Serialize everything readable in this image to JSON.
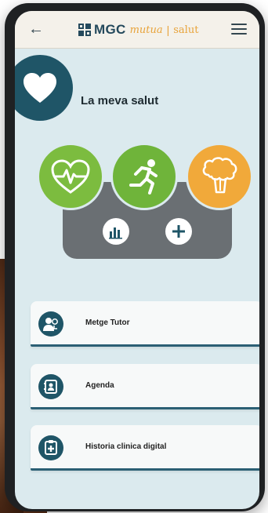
{
  "header": {
    "brand_mgc": "MGC",
    "brand_mutua": "mutua",
    "brand_sep": "|",
    "brand_salut": "salut"
  },
  "page": {
    "title": "La meva salut"
  },
  "menu_items": [
    {
      "label": "Metge Tutor",
      "icon": "doctor-tutor-icon"
    },
    {
      "label": "Agenda",
      "icon": "agenda-icon"
    },
    {
      "label": "Historia clinica digital",
      "icon": "medical-record-icon"
    }
  ],
  "colors": {
    "primary": "#1f5567",
    "green": "#7cbc3f",
    "orange": "#f1a93a",
    "panel": "#6a6f73",
    "background": "#dbeaee"
  }
}
